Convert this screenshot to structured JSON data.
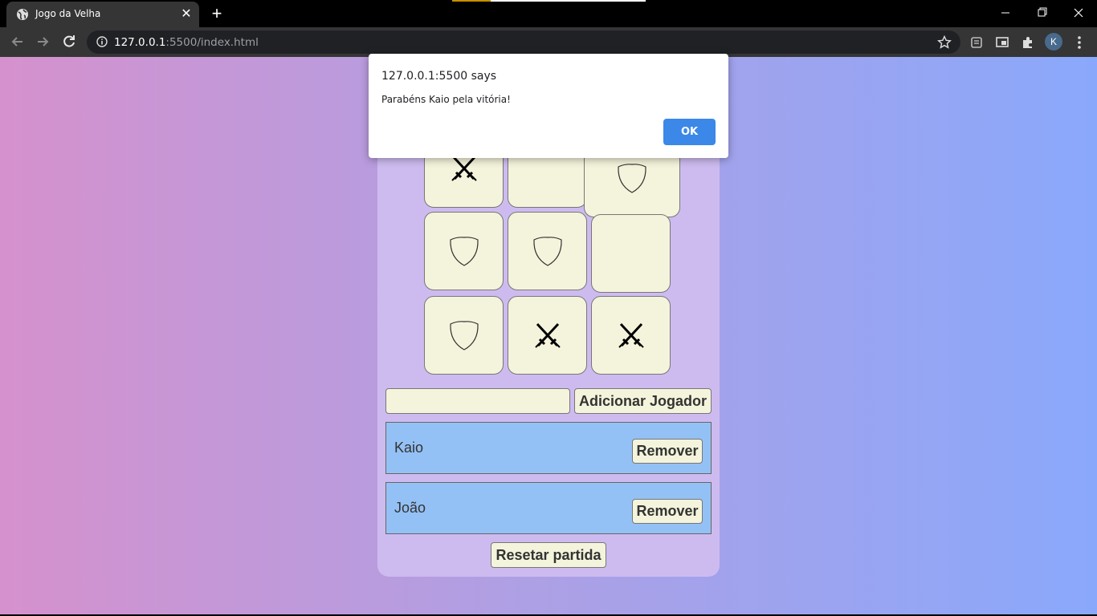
{
  "browser": {
    "tab_title": "Jogo da Velha",
    "url_host": "127.0.0.1",
    "url_rest": ":5500/index.html",
    "profile_initial": "K"
  },
  "page": {
    "heading": "Jogo da Velha",
    "board": [
      "swords",
      "",
      "shield",
      "shield",
      "shield",
      "",
      "shield",
      "swords",
      "swords"
    ],
    "player_input_value": "",
    "add_player_label": "Adicionar Jogador",
    "players": [
      {
        "name": "Kaio",
        "remove_label": "Remover"
      },
      {
        "name": "João",
        "remove_label": "Remover"
      }
    ],
    "reset_label": "Resetar partida"
  },
  "dialog": {
    "title": "127.0.0.1:5500 says",
    "message": "Parabéns Kaio pela vitória!",
    "ok_label": "OK"
  },
  "colors": {
    "heading": "#4169e1",
    "panel": "#cdbbf0",
    "cell": "#f4f4dc",
    "player_row": "#94c1f5",
    "ok_button": "#3b88e8"
  }
}
